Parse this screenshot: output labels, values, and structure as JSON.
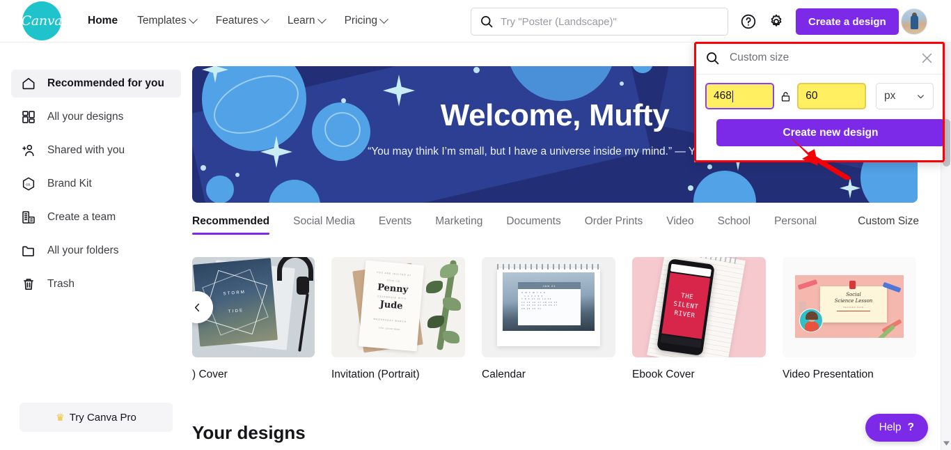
{
  "header": {
    "logo_text": "Canva",
    "nav": [
      {
        "label": "Home",
        "active": true,
        "caret": false
      },
      {
        "label": "Templates",
        "active": false,
        "caret": true
      },
      {
        "label": "Features",
        "active": false,
        "caret": true
      },
      {
        "label": "Learn",
        "active": false,
        "caret": true
      },
      {
        "label": "Pricing",
        "active": false,
        "caret": true
      }
    ],
    "search": {
      "placeholder": "Try \"Poster (Landscape)\"",
      "value": "",
      "icon": "search-icon"
    },
    "help_icon": "help-circle-icon",
    "settings_icon": "gear-icon",
    "create_design_label": "Create a design",
    "avatar_alt": "user-avatar"
  },
  "sidebar": {
    "items": [
      {
        "label": "Recommended for you",
        "icon": "home-icon",
        "active": true
      },
      {
        "label": "All your designs",
        "icon": "grid-icon",
        "active": false
      },
      {
        "label": "Shared with you",
        "icon": "add-people-icon",
        "active": false
      },
      {
        "label": "Brand Kit",
        "icon": "brand-hexagon-icon",
        "active": false
      },
      {
        "label": "Create a team",
        "icon": "building-icon",
        "active": false
      },
      {
        "label": "All your folders",
        "icon": "folder-icon",
        "active": false
      },
      {
        "label": "Trash",
        "icon": "trash-icon",
        "active": false
      }
    ],
    "try_pro_label": "Try Canva Pro",
    "try_pro_icon": "crown-icon"
  },
  "banner": {
    "title": "Welcome, Mufty",
    "quote": "“You may think I’m small, but I have a universe inside my mind.” — Yoko Ono ›"
  },
  "tabs": {
    "items": [
      {
        "label": "Recommended",
        "active": true
      },
      {
        "label": "Social Media",
        "active": false
      },
      {
        "label": "Events",
        "active": false
      },
      {
        "label": "Marketing",
        "active": false
      },
      {
        "label": "Documents",
        "active": false
      },
      {
        "label": "Order Prints",
        "active": false
      },
      {
        "label": "Video",
        "active": false
      },
      {
        "label": "School",
        "active": false
      },
      {
        "label": "Personal",
        "active": false
      }
    ],
    "custom_size_link": "Custom Size"
  },
  "cards": [
    {
      "label": ") Cover"
    },
    {
      "label": "Invitation (Portrait)"
    },
    {
      "label": "Calendar"
    },
    {
      "label": "Ebook Cover"
    },
    {
      "label": "Video Presentation"
    }
  ],
  "card_art": {
    "storm_tide_line1": "STORM",
    "storm_tide_line2": "TIDE",
    "invitation_name1": "Penny",
    "invitation_name2": "Jude",
    "calendar_month": "JAN 01",
    "ebook_line1": "THE",
    "ebook_line2": "SILENT",
    "ebook_line3": "RIVER",
    "video_line1": "Social",
    "video_line2": "Science Lesson"
  },
  "carousel": {
    "prev_icon": "chevron-left-icon"
  },
  "your_designs_heading": "Your designs",
  "custom_size_panel": {
    "search_icon": "search-icon",
    "search_text": "Custom size",
    "close_icon": "close-icon",
    "width_value": "468",
    "height_value": "60",
    "lock_icon": "unlocked-padlock-icon",
    "unit_value": "px",
    "unit_caret_icon": "chevron-down-icon",
    "create_new_label": "Create new design",
    "annotation": {
      "border_color": "#fb0006",
      "arrow_color": "#f40007",
      "arrow_name": "red-pointer-arrow"
    }
  },
  "help": {
    "label": "Help",
    "icon": "question-mark-icon"
  },
  "colors": {
    "brand_teal": "#1fc3cc",
    "brand_purple": "#7d2ae8",
    "input_highlight_yellow": "#ffef61",
    "annotation_red": "#fb0006",
    "banner_navy": "#222f77"
  },
  "scrollbar": {
    "name": "page-scrollbar"
  }
}
